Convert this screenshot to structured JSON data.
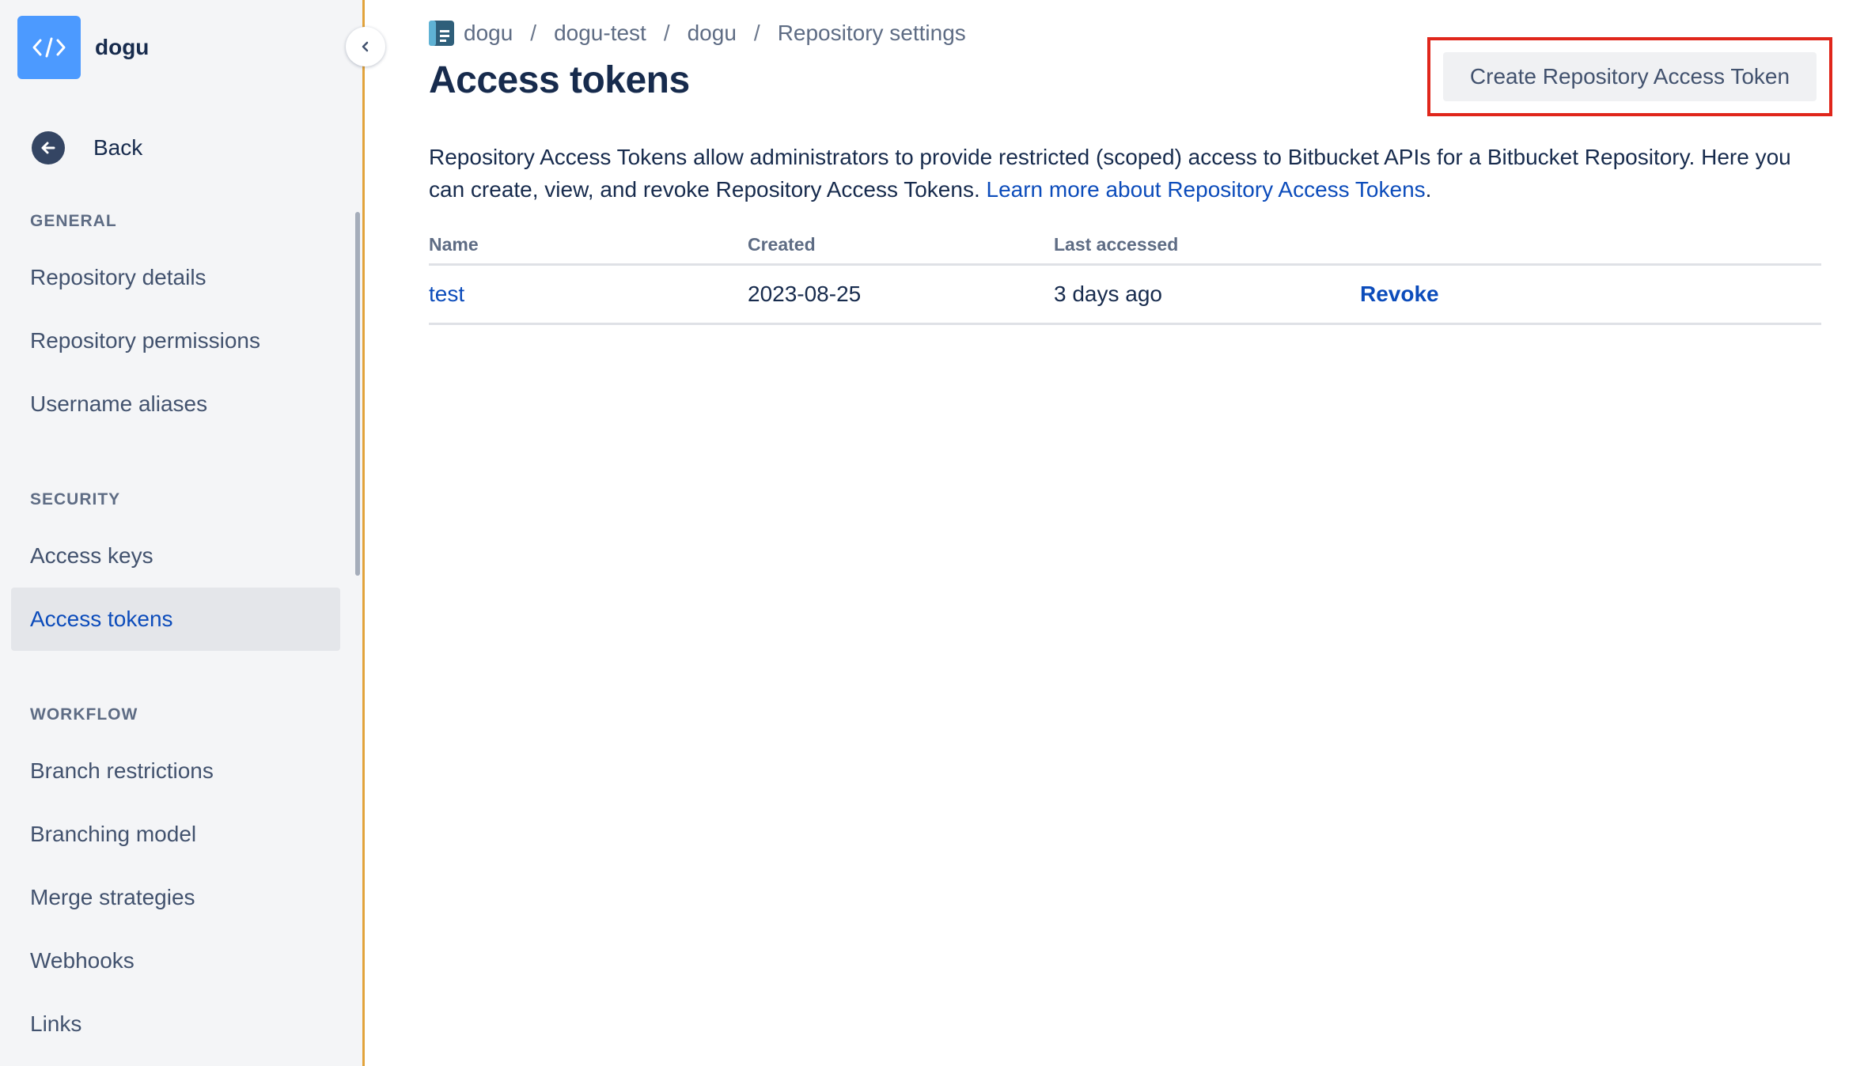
{
  "repo": {
    "name": "dogu"
  },
  "sidebar": {
    "back_label": "Back",
    "sections": [
      {
        "heading": "GENERAL",
        "items": [
          "Repository details",
          "Repository permissions",
          "Username aliases"
        ]
      },
      {
        "heading": "SECURITY",
        "items": [
          "Access keys",
          "Access tokens"
        ]
      },
      {
        "heading": "WORKFLOW",
        "items": [
          "Branch restrictions",
          "Branching model",
          "Merge strategies",
          "Webhooks",
          "Links"
        ]
      }
    ],
    "active_item": "Access tokens"
  },
  "breadcrumb": [
    "dogu",
    "dogu-test",
    "dogu",
    "Repository settings"
  ],
  "page": {
    "title": "Access tokens",
    "create_button_label": "Create Repository Access Token",
    "description_text": "Repository Access Tokens allow administrators to provide restricted (scoped) access to Bitbucket APIs for a Bitbucket Repository. Here you can create, view, and revoke Repository Access Tokens. ",
    "description_link": "Learn more about Repository Access Tokens",
    "description_end": "."
  },
  "table": {
    "headers": {
      "name": "Name",
      "created": "Created",
      "last_accessed": "Last accessed"
    },
    "rows": [
      {
        "name": "test",
        "created": "2023-08-25",
        "last_accessed": "3 days ago",
        "action": "Revoke"
      }
    ]
  },
  "colors": {
    "accent": "#0c4cbb",
    "highlight": "#e0261b",
    "repo_avatar": "#4c9aff",
    "sidebar_border": "#e2a33b"
  }
}
